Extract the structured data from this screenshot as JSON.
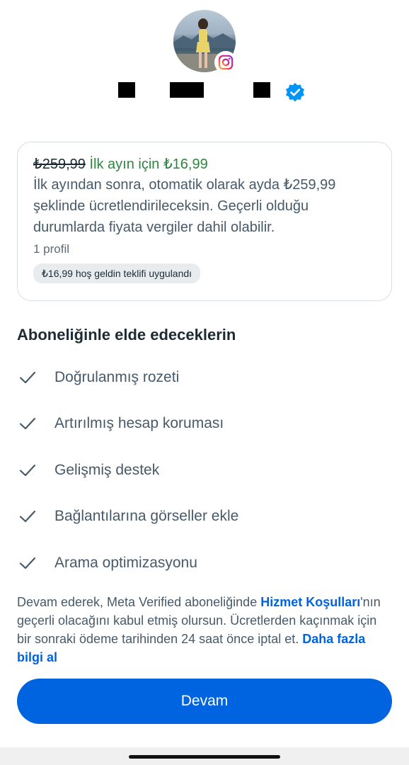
{
  "profile": {
    "avatar_icon": "profile-photo",
    "platform_icon": "instagram-icon",
    "verified_icon": "verified-badge-icon"
  },
  "offer": {
    "old_price": "₺259,99",
    "promo": "İlk ayın için ₺16,99",
    "description": "İlk ayından sonra, otomatik olarak ayda ₺259,99 şeklinde ücretlendirileceksin. Geçerli olduğu durumlarda fiyata vergiler dahil olabilir.",
    "profile_count": "1 profil",
    "applied_label": "₺16,99 hoş geldin teklifi uygulandı"
  },
  "benefits": {
    "title": "Aboneliğinle elde edeceklerin",
    "items": [
      "Doğrulanmış rozeti",
      "Artırılmış hesap koruması",
      "Gelişmiş destek",
      "Bağlantılarına görseller ekle",
      "Arama optimizasyonu"
    ]
  },
  "legal": {
    "text_before": "Devam ederek, Meta Verified aboneliğinde ",
    "terms_link": "Hizmet Koşulları",
    "text_middle": "'nın geçerli olacağını kabul etmiş olursun. Ücretlerden kaçınmak için bir sonraki ödeme tarihinden 24 saat önce iptal et. ",
    "more_link": "Daha fazla bilgi al"
  },
  "cta": {
    "label": "Devam"
  },
  "colors": {
    "accent": "#0064e0",
    "promo_green": "#2e8540",
    "text_primary": "#1c2b33",
    "text_secondary": "#465a69"
  }
}
